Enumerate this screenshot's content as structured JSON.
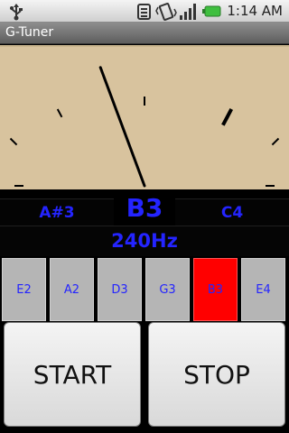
{
  "status_bar": {
    "time": "1:14 AM",
    "icons": [
      "usb-icon",
      "notification-icon",
      "vibrate-icon",
      "signal-icon",
      "battery-icon"
    ]
  },
  "app": {
    "title": "G-Tuner"
  },
  "meter": {
    "needle_level": 0.33,
    "background_color": "#d8c39e",
    "needle_color": "#000000"
  },
  "tuner": {
    "previous_note": "A#3",
    "current_note": "B3",
    "next_note": "C4",
    "frequency": "240Hz",
    "text_color": "#2424ff"
  },
  "strings": [
    {
      "label": "E2",
      "selected": false
    },
    {
      "label": "A2",
      "selected": false
    },
    {
      "label": "D3",
      "selected": false
    },
    {
      "label": "G3",
      "selected": false
    },
    {
      "label": "B3",
      "selected": true
    },
    {
      "label": "E4",
      "selected": false
    }
  ],
  "selected_string_color": "#ff0000",
  "controls": {
    "start_label": "START",
    "stop_label": "STOP"
  }
}
